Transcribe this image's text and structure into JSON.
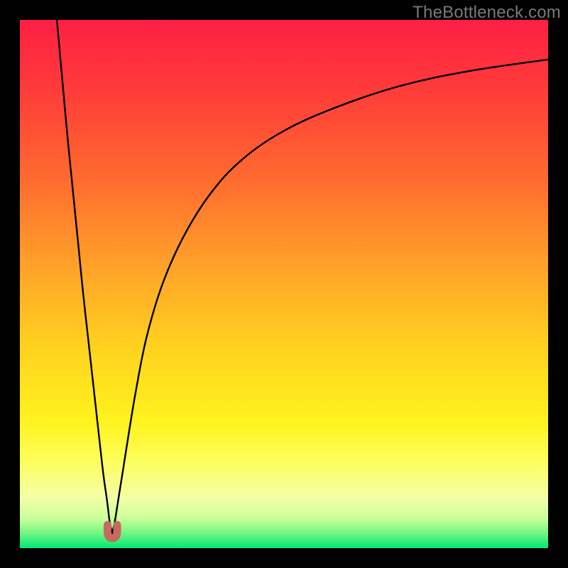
{
  "watermark": "TheBottleneck.com",
  "colors": {
    "frame": "#000000",
    "curve": "#000000",
    "marker_fill": "#c66a61",
    "marker_stroke": "#6d312b",
    "gradient_stops": [
      {
        "offset": 0.0,
        "color": "#ff1f44"
      },
      {
        "offset": 0.13,
        "color": "#ff3b3a"
      },
      {
        "offset": 0.3,
        "color": "#ff6a2f"
      },
      {
        "offset": 0.47,
        "color": "#ffa329"
      },
      {
        "offset": 0.62,
        "color": "#ffd21f"
      },
      {
        "offset": 0.76,
        "color": "#fff31e"
      },
      {
        "offset": 0.84,
        "color": "#fdff60"
      },
      {
        "offset": 0.905,
        "color": "#f3ffa8"
      },
      {
        "offset": 0.945,
        "color": "#c9ff9a"
      },
      {
        "offset": 0.975,
        "color": "#66f47e"
      },
      {
        "offset": 1.0,
        "color": "#00e878"
      }
    ]
  },
  "chart_data": {
    "type": "line",
    "title": "",
    "xlabel": "",
    "ylabel": "",
    "xlim": [
      0,
      100
    ],
    "ylim": [
      0,
      100
    ],
    "annotations": [],
    "min_point": {
      "x": 17.5,
      "y": 2.5
    },
    "series": [
      {
        "name": "left-branch",
        "x": [
          7.0,
          8.0,
          9.0,
          10.0,
          11.0,
          12.0,
          13.0,
          14.0,
          15.0,
          15.8,
          16.5,
          17.0,
          17.5
        ],
        "values": [
          100,
          89,
          78,
          68,
          58,
          48,
          39,
          30,
          21,
          14,
          9,
          5,
          2.8
        ]
      },
      {
        "name": "right-branch",
        "x": [
          17.5,
          18.0,
          18.6,
          19.4,
          20.5,
          22.0,
          24.0,
          27.0,
          31.0,
          36.0,
          42.0,
          50.0,
          60.0,
          72.0,
          85.0,
          100.0
        ],
        "values": [
          2.8,
          5.2,
          9.0,
          14.0,
          21.0,
          30.0,
          40.0,
          50.0,
          59.0,
          67.0,
          73.5,
          79.0,
          83.5,
          87.5,
          90.3,
          92.5
        ]
      },
      {
        "name": "min-marker-u",
        "x": [
          16.6,
          16.6,
          16.9,
          17.5,
          18.1,
          18.4,
          18.4
        ],
        "values": [
          4.4,
          2.9,
          2.1,
          1.9,
          2.1,
          2.9,
          4.4
        ]
      }
    ]
  }
}
